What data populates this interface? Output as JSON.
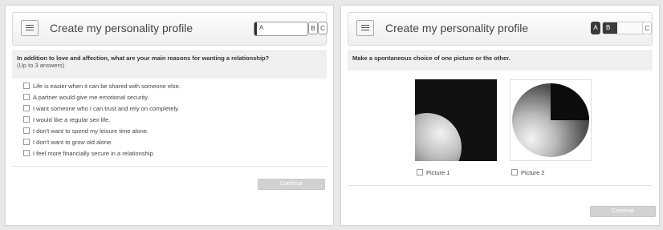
{
  "left": {
    "header": {
      "title": "Create my personality profile",
      "progress_label": "A",
      "progress_fraction": 0.05,
      "chip_b": "B",
      "chip_c": "C"
    },
    "question": {
      "text": "In addition to love and affection, what are your main reasons for wanting a relationship?",
      "subtext": "(Up to 3 answers)"
    },
    "options": [
      "Life is easier when it can be shared with someone else.",
      "A partner would give me emotional security.",
      "I want someone who I can trust and rely on completely.",
      "I would like a regular sex life.",
      "I don't want to spend my leisure time alone.",
      "I don't want to grow old alone.",
      "I feel more financially secure in a relationship."
    ],
    "continue_label": "Continue"
  },
  "right": {
    "header": {
      "title": "Create my personality profile",
      "badge_a": "A",
      "progress_label": "B",
      "progress_fraction": 0.3,
      "chip_c": "C"
    },
    "question": {
      "text": "Make a spontaneous choice of one picture or the other."
    },
    "picture1_label": "Picture 1",
    "picture2_label": "Picture 2",
    "continue_label": "Continue"
  },
  "colors": {
    "panel_bg": "#ffffff",
    "page_bg": "#e9e9e9",
    "question_bar": "#f0f0f0",
    "disabled_button": "#d2d2d2",
    "progress_fill": "#2f2f2f"
  }
}
